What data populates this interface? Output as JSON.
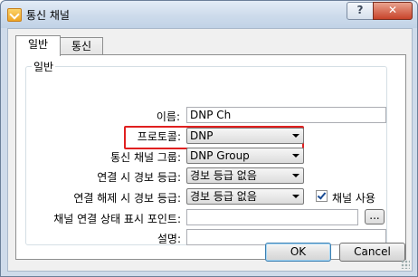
{
  "window": {
    "title": "통신 채널",
    "help_label": "?",
    "close_label": "✕"
  },
  "tabs": [
    {
      "label": "일반",
      "active": true
    },
    {
      "label": "통신",
      "active": false
    }
  ],
  "group": {
    "title": "일반"
  },
  "fields": {
    "name": {
      "label": "이름:",
      "value": "DNP Ch"
    },
    "protocol": {
      "label": "프로토콜:",
      "value": "DNP"
    },
    "channel_group": {
      "label": "통신 채널 그룹:",
      "value": "DNP Group"
    },
    "connect_alarm": {
      "label": "연결 시 경보 등급:",
      "value": "경보 등급 없음"
    },
    "disconnect_alarm": {
      "label": "연결 해제 시 경보 등급:",
      "value": "경보 등급 없음"
    },
    "channel_use": {
      "label": "채널 사용",
      "checked": true
    },
    "status_point": {
      "label": "채널 연결 상태 표시 포인트:",
      "value": "",
      "browse_label": "..."
    },
    "description": {
      "label": "설명:",
      "value": ""
    }
  },
  "buttons": {
    "ok": "OK",
    "cancel": "Cancel"
  },
  "colors": {
    "highlight": "#e02020",
    "close_button": "#c8432a"
  }
}
